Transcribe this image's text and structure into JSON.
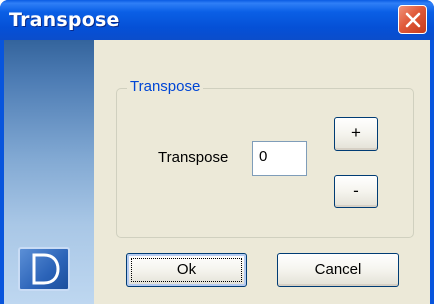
{
  "window": {
    "title": "Transpose",
    "close_icon": "close-x-icon"
  },
  "side_panel": {
    "logo_icon": "d-logo-icon"
  },
  "group": {
    "legend": "Transpose",
    "field_label": "Transpose",
    "field_value": "0",
    "plus_label": "+",
    "minus_label": "-"
  },
  "buttons": {
    "ok_label": "Ok",
    "cancel_label": "Cancel"
  },
  "colors": {
    "titlebar": "#0855dd",
    "close_button": "#e05a3a",
    "client_background": "#ece9d8",
    "legend_text": "#0046d5"
  }
}
